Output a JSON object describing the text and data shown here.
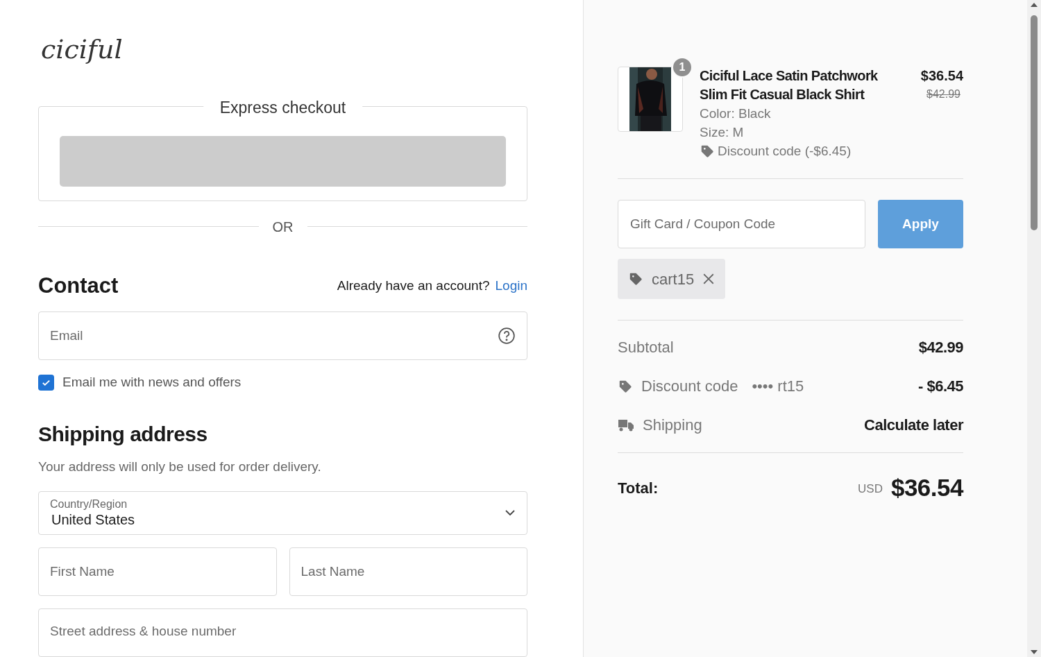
{
  "logo": "ciciful",
  "express": {
    "title": "Express checkout"
  },
  "divider": "OR",
  "contact": {
    "title": "Contact",
    "prompt": "Already have an account?",
    "login": "Login",
    "email_placeholder": "Email",
    "newsletter": {
      "label": "Email me with news and offers",
      "checked": true
    }
  },
  "shipping": {
    "title": "Shipping address",
    "note": "Your address will only be used for order delivery.",
    "country_label": "Country/Region",
    "country": "United States",
    "first_name": "First Name",
    "last_name": "Last Name",
    "street": "Street address & house number"
  },
  "item": {
    "quantity": "1",
    "name": "Ciciful Lace Satin Patchwork Slim Fit Casual Black Shirt",
    "variant_color": "Color: Black",
    "size": "Size: M",
    "discount": "Discount code (-$6.45)",
    "price": "$36.54",
    "old_price": "$42.99"
  },
  "coupon": {
    "placeholder": "Gift Card / Coupon Code",
    "button": "Apply",
    "applied": "cart15"
  },
  "summary": [
    {
      "kind": "plain",
      "label": "Subtotal",
      "value": "$42.99"
    },
    {
      "kind": "discount",
      "label": "Discount code",
      "code": "•••• rt15",
      "value": "- $6.45"
    },
    {
      "kind": "shipping",
      "label": "Shipping",
      "value": "Calculate later"
    }
  ],
  "total": {
    "label": "Total:",
    "currency": "USD",
    "value": "$36.54"
  }
}
